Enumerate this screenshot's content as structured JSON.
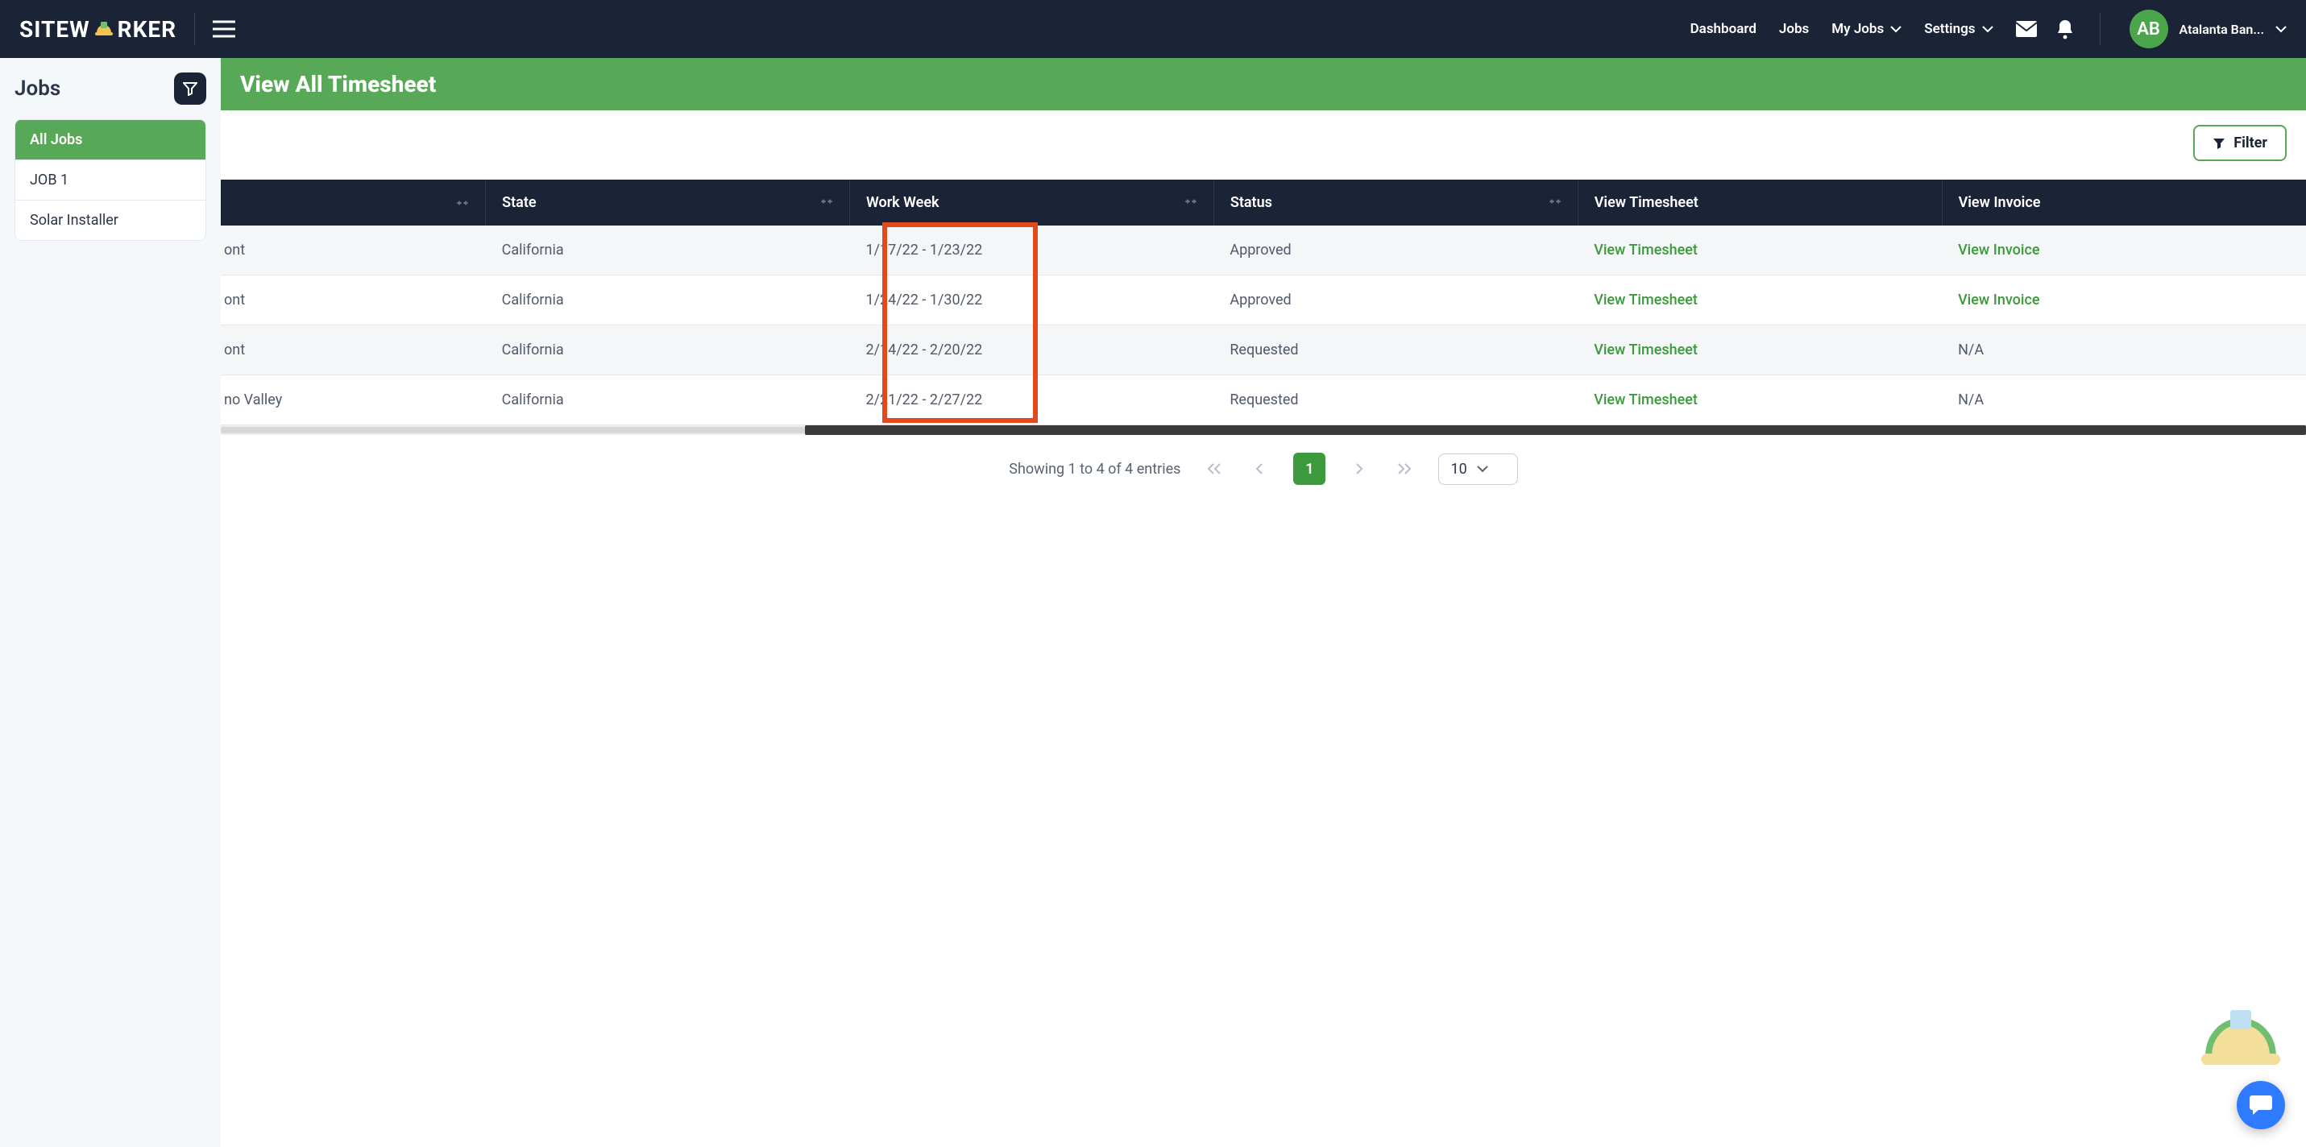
{
  "brand": {
    "pre": "SITEW",
    "post": "RKER"
  },
  "nav": {
    "dashboard": "Dashboard",
    "jobs": "Jobs",
    "myjobs": "My Jobs",
    "settings": "Settings"
  },
  "user": {
    "initials": "AB",
    "name": "Atalanta Ban..."
  },
  "sidebar": {
    "title": "Jobs",
    "items": [
      {
        "label": "All Jobs",
        "active": true
      },
      {
        "label": "JOB 1",
        "active": false
      },
      {
        "label": "Solar Installer",
        "active": false
      }
    ]
  },
  "page": {
    "title": "View All Timesheet",
    "filter_button": "Filter"
  },
  "table": {
    "headers": {
      "blank": "",
      "state": "State",
      "work_week": "Work Week",
      "status": "Status",
      "view_timesheet": "View Timesheet",
      "view_invoice": "View Invoice"
    },
    "rows": [
      {
        "loc": "ont",
        "state": "California",
        "week": "1/17/22 - 1/23/22",
        "status": "Approved",
        "vt": "View Timesheet",
        "vi": "View Invoice",
        "vi_link": true
      },
      {
        "loc": "ont",
        "state": "California",
        "week": "1/24/22 - 1/30/22",
        "status": "Approved",
        "vt": "View Timesheet",
        "vi": "View Invoice",
        "vi_link": true
      },
      {
        "loc": "ont",
        "state": "California",
        "week": "2/14/22 - 2/20/22",
        "status": "Requested",
        "vt": "View Timesheet",
        "vi": "N/A",
        "vi_link": false
      },
      {
        "loc": "no Valley",
        "state": "California",
        "week": "2/21/22 - 2/27/22",
        "status": "Requested",
        "vt": "View Timesheet",
        "vi": "N/A",
        "vi_link": false
      }
    ]
  },
  "pager": {
    "text": "Showing 1 to 4 of 4 entries",
    "page": "1",
    "page_size": "10"
  }
}
